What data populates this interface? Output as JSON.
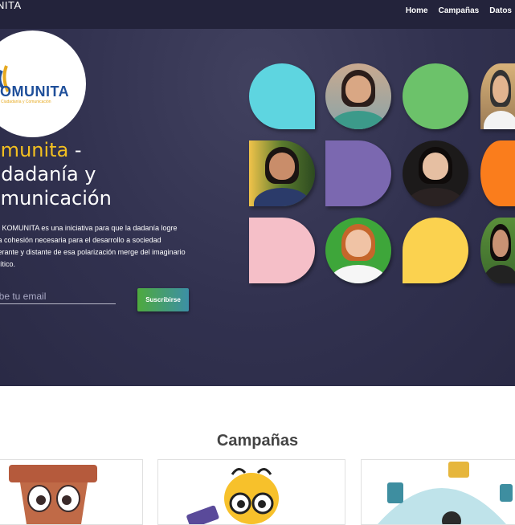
{
  "header": {
    "brand": "NITA",
    "nav": [
      "Home",
      "Campañas",
      "Datos"
    ]
  },
  "hero": {
    "logo_word": "OMUNITA",
    "logo_tagline": "Ciudadanía y Comunicación",
    "headline_accent": "omunita",
    "headline_line1_rest": " -",
    "headline_line2": "udadanía y",
    "headline_line3": "omunicación",
    "intro": "cto KOMUNITA es una iniciativa para que la dadanía logre esa cohesión necesaria para el desarrollo a sociedad tolerante y distante de esa polarización merge del imaginario político.",
    "email_placeholder": "ribe tu email",
    "subscribe_label": "Suscribirse"
  },
  "colors": {
    "teal": "#5ed5e0",
    "green": "#6cc26a",
    "purple": "#7b68b0",
    "orange": "#fa7d1c",
    "pink": "#f5bfc8",
    "yellow": "#fbd24f",
    "accent_yellow": "#f3c020"
  },
  "section": {
    "title": "Campañas"
  }
}
